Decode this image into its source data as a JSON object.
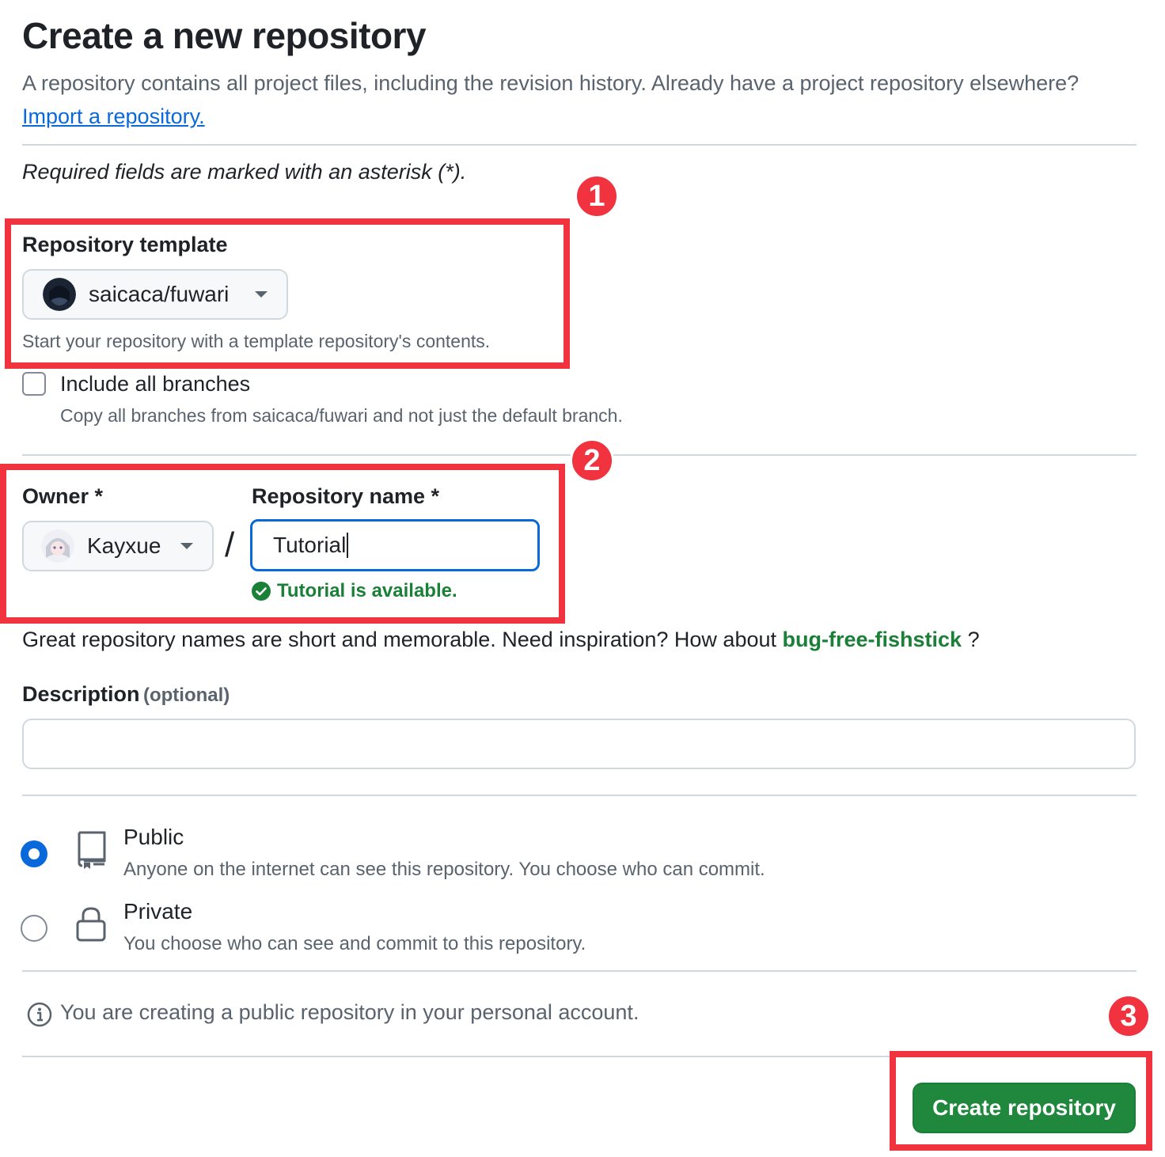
{
  "header": {
    "title": "Create a new repository",
    "intro_text": "A repository contains all project files, including the revision history. Already have a project repository elsewhere?",
    "import_link": "Import a repository."
  },
  "required_note": "Required fields are marked with an asterisk (*).",
  "template": {
    "label": "Repository template",
    "selected": "saicaca/fuwari",
    "hint": "Start your repository with a template repository's contents."
  },
  "branches": {
    "label": "Include all branches",
    "hint": "Copy all branches from saicaca/fuwari and not just the default branch.",
    "checked": false
  },
  "owner": {
    "label": "Owner *",
    "selected": "Kayxue"
  },
  "separator": "/",
  "repo_name": {
    "label": "Repository name *",
    "value": "Tutorial",
    "availability": "Tutorial is available."
  },
  "inspiration": {
    "text": "Great repository names are short and memorable. Need inspiration? How about",
    "suggestion": "bug-free-fishstick",
    "trailing": "?"
  },
  "description": {
    "label": "Description",
    "optional": "(optional)",
    "value": ""
  },
  "visibility": {
    "options": [
      {
        "title": "Public",
        "desc": "Anyone on the internet can see this repository. You choose who can commit.",
        "selected": true,
        "icon": "repo-icon"
      },
      {
        "title": "Private",
        "desc": "You choose who can see and commit to this repository.",
        "selected": false,
        "icon": "lock-icon"
      }
    ]
  },
  "info_note": "You are creating a public repository in your personal account.",
  "create_button": "Create repository",
  "annotations": [
    "1",
    "2",
    "3"
  ],
  "colors": {
    "accent_blue": "#0969da",
    "success_green": "#1a7f37",
    "button_green": "#1f883d",
    "highlight_red": "#f0333f"
  }
}
